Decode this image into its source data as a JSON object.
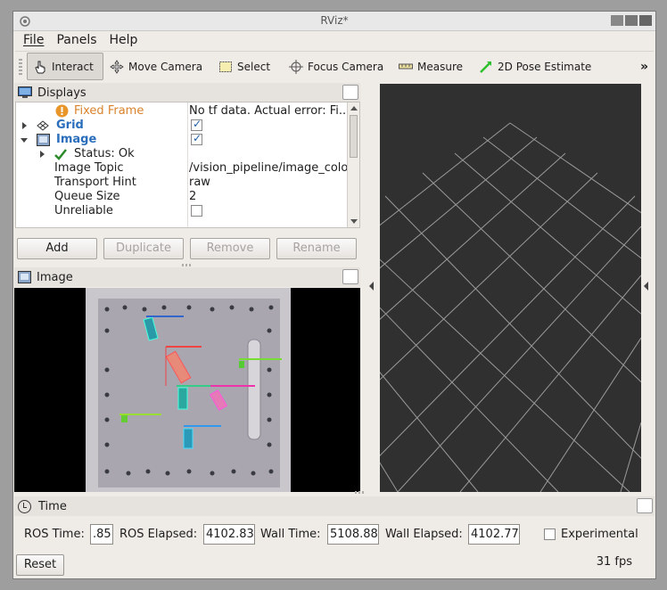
{
  "window": {
    "title": "RViz*"
  },
  "menu": [
    "File",
    "Panels",
    "Help"
  ],
  "toolbar": {
    "tools": [
      {
        "label": "Interact",
        "icon": "hand-cursor-icon",
        "active": true
      },
      {
        "label": "Move Camera",
        "icon": "move-arrows-icon",
        "active": false
      },
      {
        "label": "Select",
        "icon": "select-box-icon",
        "active": false
      },
      {
        "label": "Focus Camera",
        "icon": "crosshair-icon",
        "active": false
      },
      {
        "label": "Measure",
        "icon": "ruler-icon",
        "active": false
      },
      {
        "label": "2D Pose Estimate",
        "icon": "green-arrow-icon",
        "active": false
      }
    ],
    "more": "»"
  },
  "displays": {
    "title": "Displays",
    "rows": [
      {
        "key": "Fixed Frame",
        "value": "No tf data.  Actual error: Fi...",
        "status": "error",
        "color": "#d9822b"
      },
      {
        "key": "Grid",
        "value": "",
        "checked": true,
        "color": "#2a6ebb"
      },
      {
        "key": "Image",
        "value": "",
        "checked": true,
        "color": "#2a6ebb"
      },
      {
        "key": "Status: Ok",
        "value": ""
      },
      {
        "key": "Image Topic",
        "value": "/vision_pipeline/image_colo"
      },
      {
        "key": "Transport Hint",
        "value": "raw"
      },
      {
        "key": "Queue Size",
        "value": "2"
      },
      {
        "key": "Unreliable",
        "value": "",
        "checked": false
      }
    ],
    "buttons": {
      "add": "Add",
      "duplicate": "Duplicate",
      "remove": "Remove",
      "rename": "Rename"
    }
  },
  "image_panel": {
    "title": "Image"
  },
  "time": {
    "title": "Time",
    "ros_time_label": "ROS Time:",
    "ros_time": ".85",
    "ros_elapsed_label": "ROS Elapsed:",
    "ros_elapsed": "4102.83",
    "wall_time_label": "Wall Time:",
    "wall_time": "5108.88",
    "wall_elapsed_label": "Wall Elapsed:",
    "wall_elapsed": "4102.77",
    "experimental_label": "Experimental",
    "reset": "Reset",
    "fps": "31 fps"
  },
  "colors": {
    "accent_blue": "#2a6ebb",
    "warning_orange": "#e8952a",
    "render_bg": "#303030"
  }
}
